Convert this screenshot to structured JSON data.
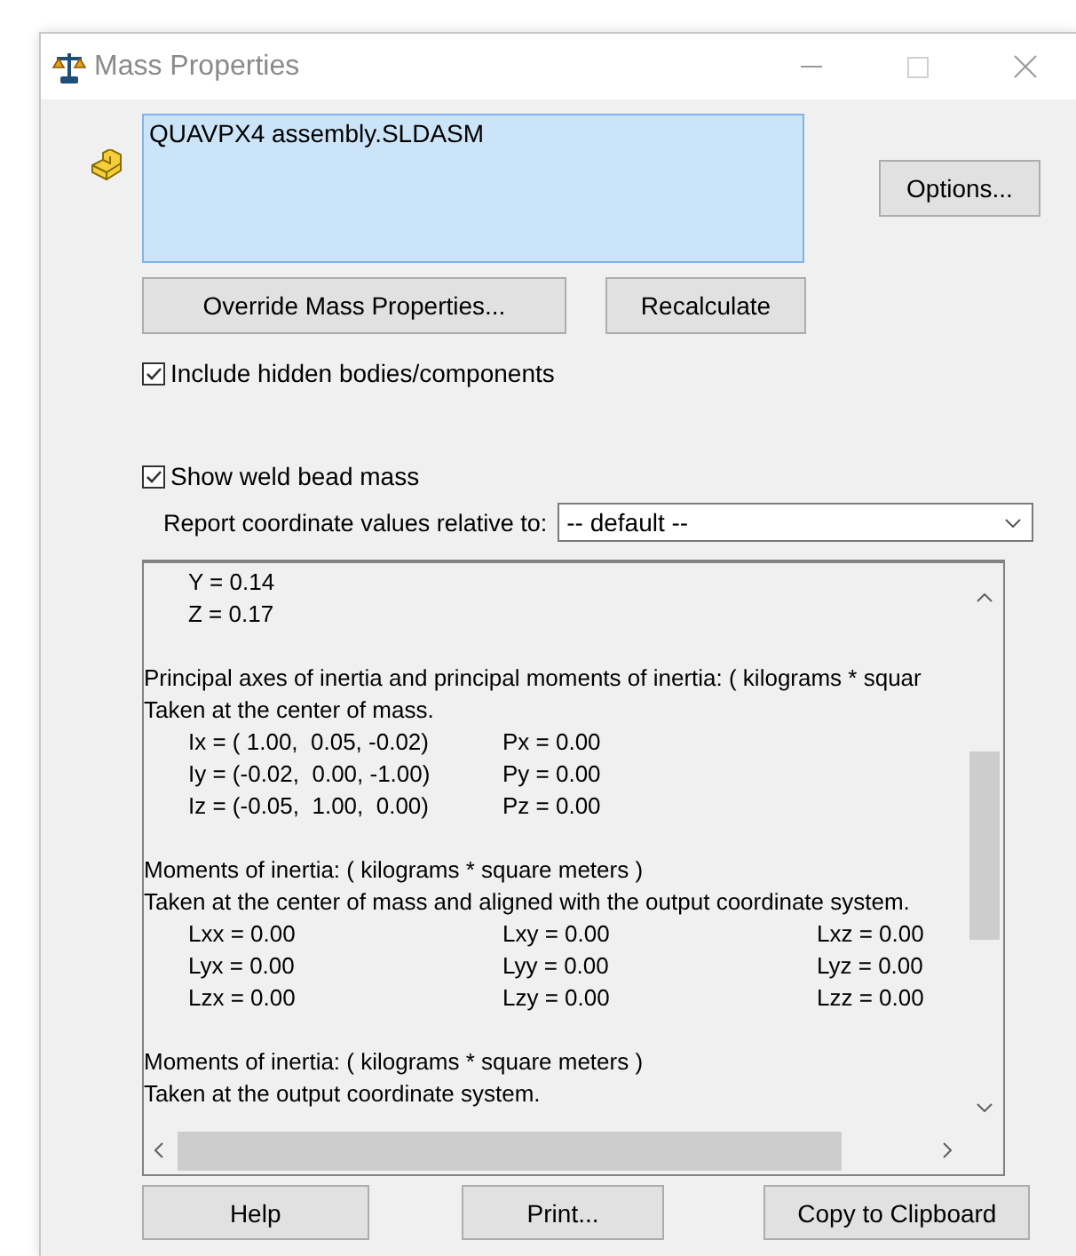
{
  "window": {
    "title": "Mass Properties",
    "controls": [
      {
        "kind": "minimize",
        "disabled": false
      },
      {
        "kind": "maximize",
        "disabled": true
      },
      {
        "kind": "close",
        "disabled": false
      }
    ]
  },
  "selection": {
    "items": [
      {
        "label": "QUAVPX4 assembly.SLDASM",
        "selected": true
      }
    ]
  },
  "options_button": "Options...",
  "action_buttons": [
    "Override Mass Properties...",
    "Recalculate"
  ],
  "checkboxes": [
    {
      "label": "Include hidden bodies/components",
      "checked": true
    },
    {
      "label": "Show weld bead mass",
      "checked": true
    }
  ],
  "report": {
    "label": "Report coordinate values relative to:",
    "value": "-- default --"
  },
  "output": [
    {
      "kind": "indent",
      "text": "Y = 0.14"
    },
    {
      "kind": "indent",
      "text": "Z = 0.17"
    },
    {
      "kind": "blank"
    },
    {
      "kind": "text",
      "text": "Principal axes of inertia and principal moments of inertia: ( kilograms * squar"
    },
    {
      "kind": "text",
      "text": "Taken at the center of mass."
    },
    {
      "kind": "row",
      "cells": [
        "Ix = ( 1.00,  0.05, -0.02)",
        "Px = 0.00"
      ]
    },
    {
      "kind": "row",
      "cells": [
        "Iy = (-0.02,  0.00, -1.00)",
        "Py = 0.00"
      ]
    },
    {
      "kind": "row",
      "cells": [
        "Iz = (-0.05,  1.00,  0.00)",
        "Pz = 0.00"
      ]
    },
    {
      "kind": "blank"
    },
    {
      "kind": "text",
      "text": "Moments of inertia: ( kilograms * square meters )"
    },
    {
      "kind": "text",
      "text": "Taken at the center of mass and aligned with the output coordinate system."
    },
    {
      "kind": "row",
      "cells": [
        "Lxx = 0.00",
        "Lxy = 0.00",
        "Lxz = 0.00"
      ]
    },
    {
      "kind": "row",
      "cells": [
        "Lyx = 0.00",
        "Lyy = 0.00",
        "Lyz = 0.00"
      ]
    },
    {
      "kind": "row",
      "cells": [
        "Lzx = 0.00",
        "Lzy = 0.00",
        "Lzz = 0.00"
      ]
    },
    {
      "kind": "blank"
    },
    {
      "kind": "text",
      "text": "Moments of inertia: ( kilograms * square meters )"
    },
    {
      "kind": "text",
      "text": "Taken at the output coordinate system."
    }
  ],
  "footer_buttons": [
    "Help",
    "Print...",
    "Copy to Clipboard"
  ]
}
